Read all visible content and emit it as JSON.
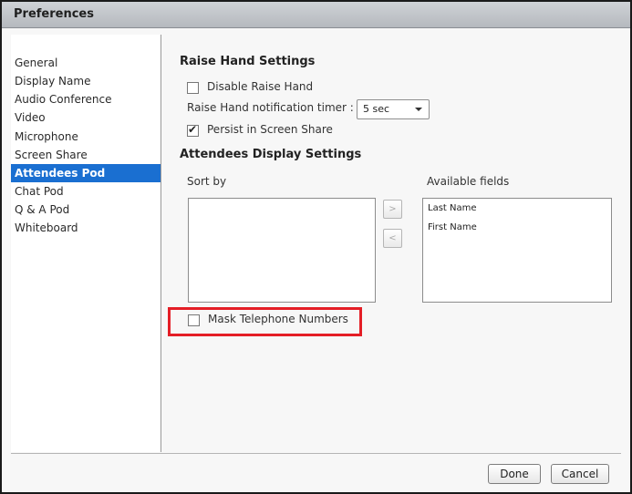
{
  "window": {
    "title": "Preferences"
  },
  "sidebar": {
    "items": [
      {
        "label": "General"
      },
      {
        "label": "Display Name"
      },
      {
        "label": "Audio Conference"
      },
      {
        "label": "Video"
      },
      {
        "label": "Microphone"
      },
      {
        "label": "Screen Share"
      },
      {
        "label": "Attendees Pod",
        "selected": true
      },
      {
        "label": "Chat Pod"
      },
      {
        "label": "Q & A Pod"
      },
      {
        "label": "Whiteboard"
      }
    ]
  },
  "raise_hand": {
    "heading": "Raise Hand Settings",
    "disable_label": "Disable Raise Hand",
    "disable_checked": false,
    "timer_label": "Raise Hand notification timer :",
    "timer_value": "5 sec",
    "persist_label": "Persist in Screen Share",
    "persist_checked": true
  },
  "attendees_display": {
    "heading": "Attendees Display Settings",
    "sort_by_label": "Sort by",
    "available_label": "Available fields",
    "sort_by_items": [],
    "available_items": [
      "Last Name",
      "First Name"
    ],
    "move_right_label": ">",
    "move_left_label": "<",
    "mask_label": "Mask Telephone Numbers",
    "mask_checked": false
  },
  "footer": {
    "done_label": "Done",
    "cancel_label": "Cancel"
  },
  "colors": {
    "selection": "#1a6fd1",
    "highlight": "#e41e26"
  }
}
